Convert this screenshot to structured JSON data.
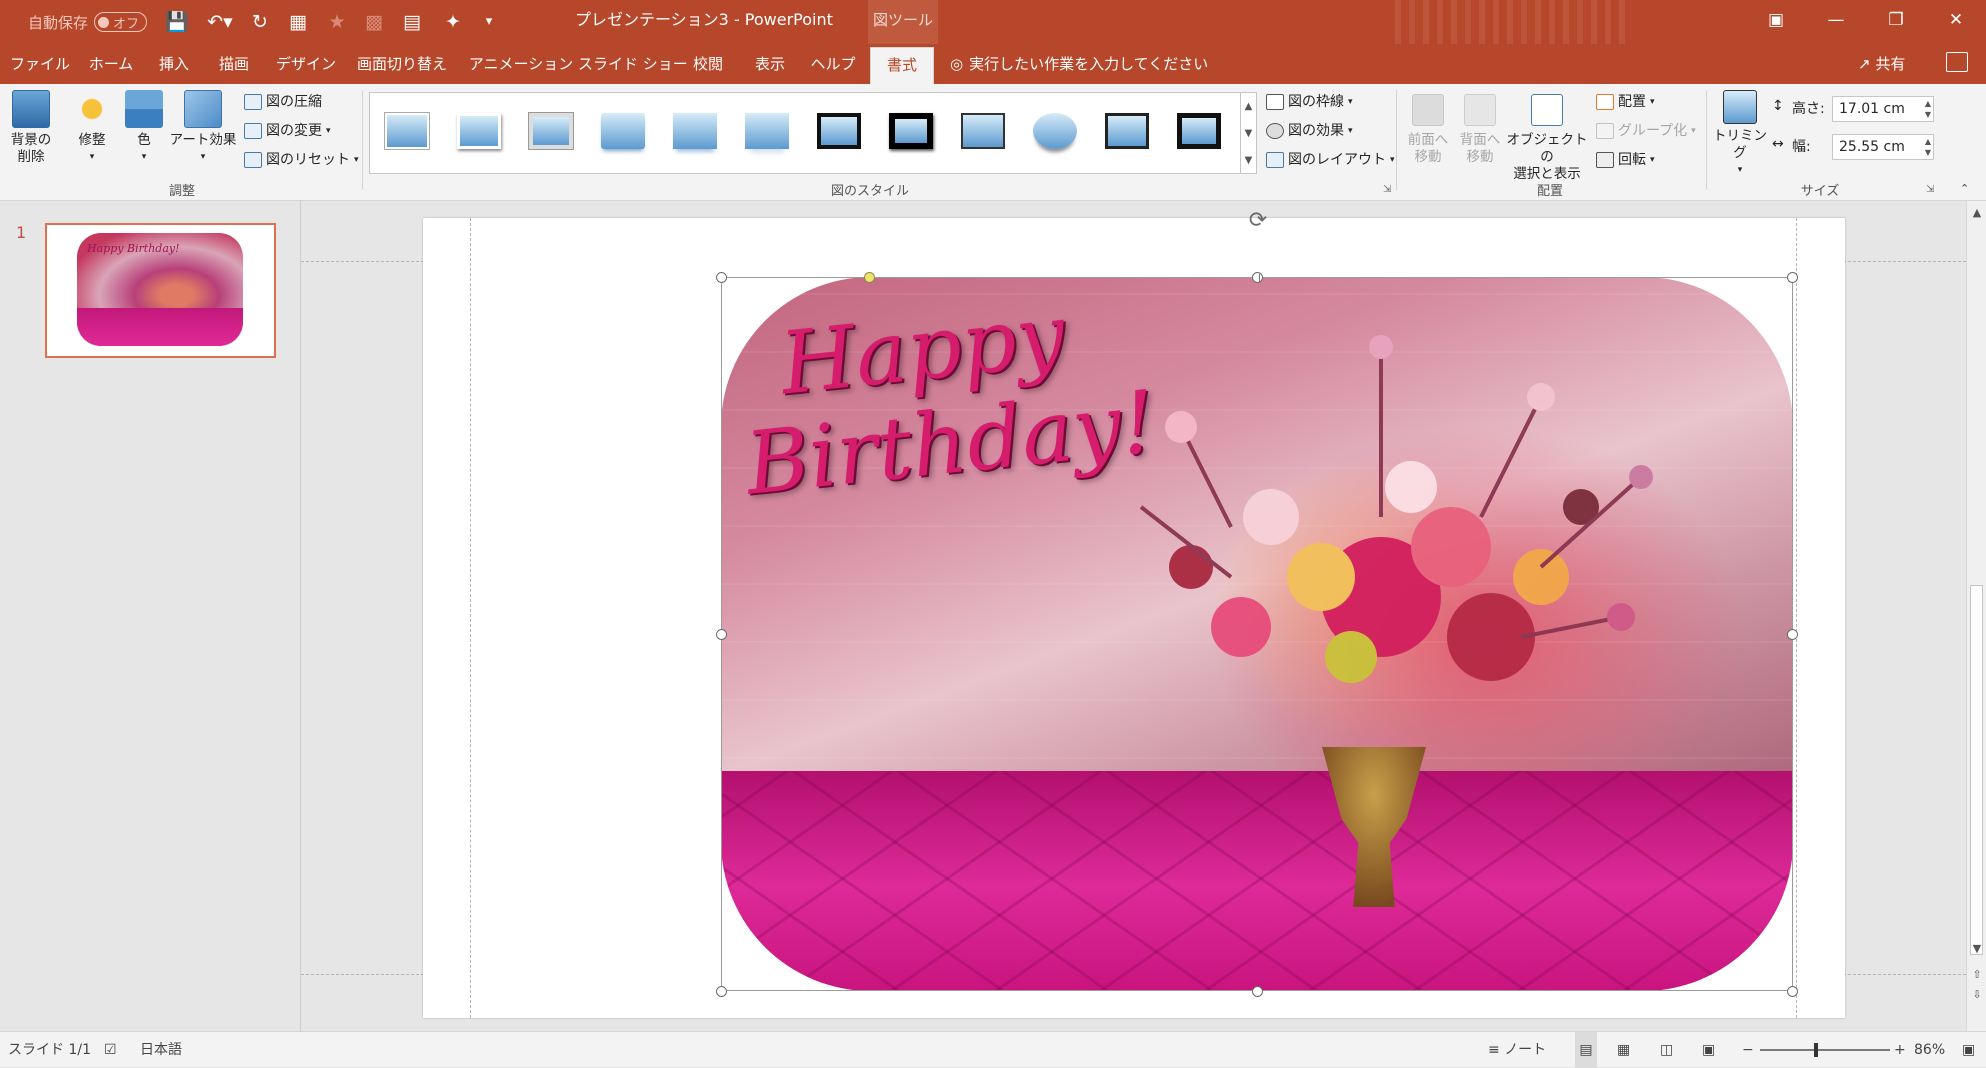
{
  "titlebar": {
    "autosave_label": "自動保存",
    "autosave_state": "オフ",
    "doc_title": "プレゼンテーション3  -  PowerPoint",
    "context_tools": "図ツール",
    "window_controls": [
      "restore-ribbon-icon",
      "minimize-icon",
      "maximize-icon",
      "close-icon"
    ]
  },
  "tabs": [
    "ファイル",
    "ホーム",
    "挿入",
    "描画",
    "デザイン",
    "画面切り替え",
    "アニメーション",
    "スライド ショー",
    "校閲",
    "表示",
    "ヘルプ",
    "書式"
  ],
  "active_tab": "書式",
  "tellme": "実行したい作業を入力してください",
  "share_label": "共有",
  "ribbon": {
    "adjust": {
      "remove_bg": "背景の\n削除",
      "corrections": "修整",
      "color": "色",
      "artistic": "アート効果",
      "compress": "図の圧縮",
      "change": "図の変更",
      "reset": "図のリセット",
      "group_label": "調整"
    },
    "styles": {
      "group_label": "図のスタイル",
      "border": "図の枠線",
      "effects": "図の効果",
      "layout": "図のレイアウト"
    },
    "arrange": {
      "bring_forward": "前面へ\n移動",
      "send_backward": "背面へ\n移動",
      "selection_pane": "オブジェクトの\n選択と表示",
      "align": "配置",
      "group": "グループ化",
      "rotate": "回転",
      "group_label": "配置"
    },
    "size": {
      "crop": "トリミング",
      "height_label": "高さ:",
      "height_value": "17.01 cm",
      "width_label": "幅:",
      "width_value": "25.55 cm",
      "group_label": "サイズ"
    }
  },
  "slides_panel": {
    "slide_number": "1",
    "thumb_text": "Happy Birthday!"
  },
  "slide": {
    "greeting_line1": "Happy",
    "greeting_line2": "Birthday!"
  },
  "statusbar": {
    "slide_info": "スライド 1/1",
    "language": "日本語",
    "notes": "ノート",
    "zoom": "86%",
    "zoom_fraction": 0.43
  }
}
